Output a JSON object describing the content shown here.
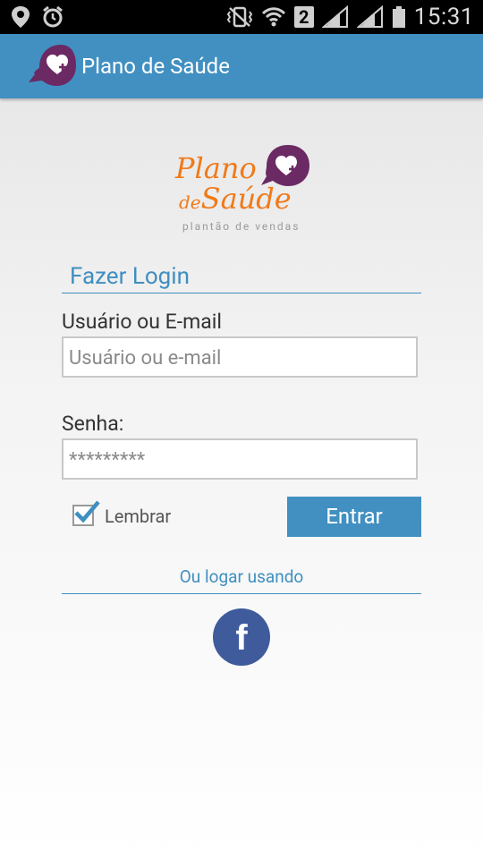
{
  "status_bar": {
    "time": "15:31",
    "sim_slot": "2",
    "icons": [
      "location-pin-icon",
      "alarm-icon",
      "vibrate-icon",
      "wifi-icon",
      "signal-icon",
      "signal-icon",
      "battery-icon"
    ]
  },
  "app_bar": {
    "title": "Plano de Saúde",
    "icon": "heart-chat-bubble-icon",
    "color": "#4190c1"
  },
  "logo": {
    "line1": "Plano",
    "line2_small": "de",
    "line2": "Saúde",
    "tagline": "plantão de vendas",
    "brand_orange": "#f07a1a",
    "brand_purple": "#7b2d6e"
  },
  "login": {
    "title": "Fazer Login",
    "username_label": "Usuário ou E-mail",
    "username_placeholder": "Usuário ou e-mail",
    "password_label": "Senha:",
    "password_value": "*********",
    "remember_label": "Lembrar",
    "remember_checked": true,
    "submit_label": "Entrar",
    "alt_login_text": "Ou logar usando",
    "facebook_glyph": "f"
  }
}
